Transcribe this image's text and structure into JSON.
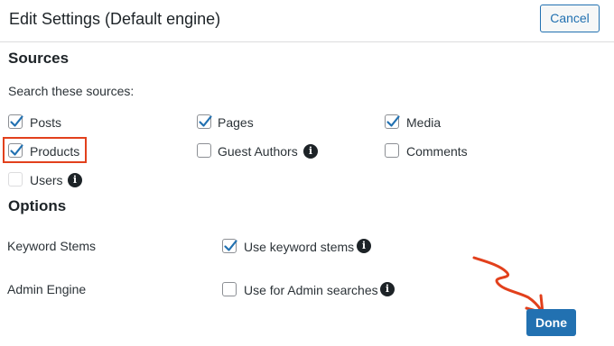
{
  "dialog": {
    "title": "Edit Settings (Default engine)",
    "cancel_label": "Cancel",
    "done_label": "Done"
  },
  "sources": {
    "heading": "Sources",
    "subheading": "Search these sources:",
    "items": [
      {
        "label": "Posts",
        "checked": true
      },
      {
        "label": "Pages",
        "checked": true
      },
      {
        "label": "Media",
        "checked": true
      },
      {
        "label": "Products",
        "checked": true
      },
      {
        "label": "Guest Authors",
        "checked": false,
        "info": true
      },
      {
        "label": "Comments",
        "checked": false
      },
      {
        "label": "Users",
        "checked": false,
        "info": true,
        "disabled": true
      }
    ]
  },
  "options": {
    "heading": "Options",
    "rows": [
      {
        "label": "Keyword Stems",
        "option_label": "Use keyword stems",
        "checked": true
      },
      {
        "label": "Admin Engine",
        "option_label": "Use for Admin searches",
        "checked": false
      }
    ]
  },
  "colors": {
    "accent": "#2271b1",
    "annotation": "#e2401c"
  },
  "icons": [
    "checkmark-icon",
    "info-icon",
    "red-arrow-annotation"
  ]
}
